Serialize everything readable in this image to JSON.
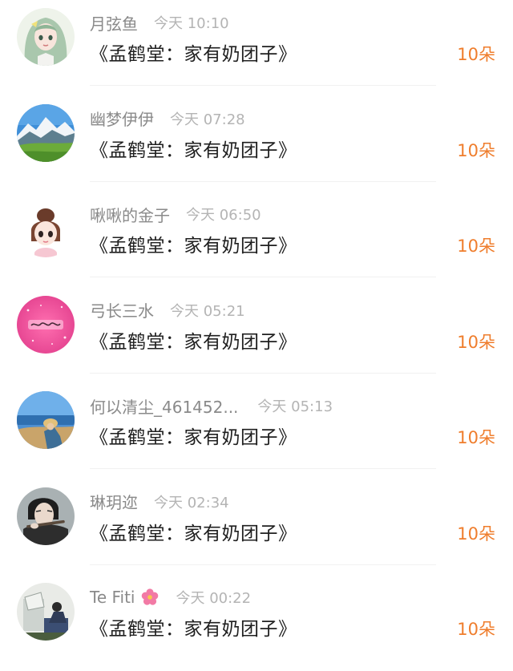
{
  "colors": {
    "username": "#8a8a8a",
    "time": "#b4b4b4",
    "message": "#1f1f1f",
    "gift_accent": "#ef7d2c",
    "divider": "#f1f1f1"
  },
  "items": [
    {
      "username": "月弦鱼",
      "time": "今天 10:10",
      "message": "《孟鹤堂：家有奶团子》",
      "gift": "10朵",
      "avatar_icon": "anime-girl-avatar"
    },
    {
      "username": "幽梦伊伊",
      "time": "今天 07:28",
      "message": "《孟鹤堂：家有奶团子》",
      "gift": "10朵",
      "avatar_icon": "mountain-landscape-avatar"
    },
    {
      "username": "啾啾的金子",
      "time": "今天 06:50",
      "message": "《孟鹤堂：家有奶团子》",
      "gift": "10朵",
      "avatar_icon": "cartoon-girl-avatar"
    },
    {
      "username": "弓长三水",
      "time": "今天 05:21",
      "message": "《孟鹤堂：家有奶团子》",
      "gift": "10朵",
      "avatar_icon": "pink-glitter-avatar"
    },
    {
      "username": "何以清尘_461452...",
      "time": "今天 05:13",
      "message": "《孟鹤堂：家有奶团子》",
      "gift": "10朵",
      "avatar_icon": "seaside-person-avatar"
    },
    {
      "username": "琳玥迩",
      "time": "今天 02:34",
      "message": "《孟鹤堂：家有奶团子》",
      "gift": "10朵",
      "avatar_icon": "man-with-flute-avatar"
    },
    {
      "username": "Te Fiti",
      "time": "今天 00:22",
      "message": "《孟鹤堂：家有奶团子》",
      "gift": "10朵",
      "avatar_icon": "sitting-person-avatar",
      "name_icon": "flower-icon"
    }
  ]
}
